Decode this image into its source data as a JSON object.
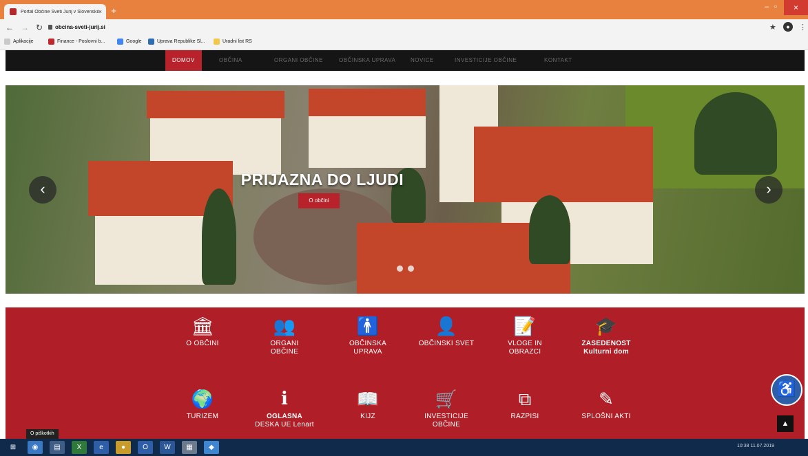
{
  "browser": {
    "tab_title": "Portal Občine Sveti Jurij v Slovenskih goricah",
    "url": "obcina-sveti-jurij.si",
    "bookmarks": [
      "Aplikacije",
      "Finance - Poslovni b...",
      "Google",
      "Uprava Republike Sl...",
      "Uradni list RS"
    ]
  },
  "site_nav": [
    "DOMOV",
    "OBČINA",
    "ORGANI OBČINE",
    "OBČINSKA UPRAVA",
    "NOVICE",
    "INVESTICIJE OBČINE",
    "KONTAKT"
  ],
  "hero": {
    "title": "PRIJAZNA DO LJUDI",
    "button": "O občini"
  },
  "tiles_row1": [
    {
      "icon": "institution-icon",
      "glyph": "🏛",
      "line1": "O OBČINI",
      "line2": ""
    },
    {
      "icon": "users-icon",
      "glyph": "👥",
      "line1": "ORGANI",
      "line2": "OBČINE"
    },
    {
      "icon": "person-icon",
      "glyph": "🚹",
      "line1": "OBČINSKA",
      "line2": "UPRAVA"
    },
    {
      "icon": "user-circle-icon",
      "glyph": "👤",
      "line1": "OBČINSKI SVET",
      "line2": ""
    },
    {
      "icon": "form-icon",
      "glyph": "📝",
      "line1": "VLOGE IN",
      "line2": "OBRAZCI"
    },
    {
      "icon": "graduation-cap-icon",
      "glyph": "🎓",
      "line1": "ZASEDENOST",
      "line2": "Kulturni dom"
    }
  ],
  "tiles_row2": [
    {
      "icon": "globe-icon",
      "glyph": "🌍",
      "line1": "TURIZEM",
      "line2": ""
    },
    {
      "icon": "info-icon",
      "glyph": "i",
      "line1": "OGLASNA",
      "line2": "DESKA UE Lenart"
    },
    {
      "icon": "book-icon",
      "glyph": "📖",
      "line1": "KIJZ",
      "line2": ""
    },
    {
      "icon": "cart-plus-icon",
      "glyph": "🛒",
      "line1": "INVESTICIJE",
      "line2": "OBČINE"
    },
    {
      "icon": "copy-icon",
      "glyph": "⧉",
      "line1": "RAZPISI",
      "line2": ""
    },
    {
      "icon": "edit-icon",
      "glyph": "✎",
      "line1": "SPLOŠNI AKTI",
      "line2": ""
    }
  ],
  "taskbar": {
    "tooltip": "O piškotkih",
    "tray_text": "10:38 11.07.2019"
  },
  "colors": {
    "brand_red": "#b01f27",
    "nav_dark": "#151515",
    "chrome_orange": "#e8813e",
    "taskbar": "#0f2a4a"
  }
}
